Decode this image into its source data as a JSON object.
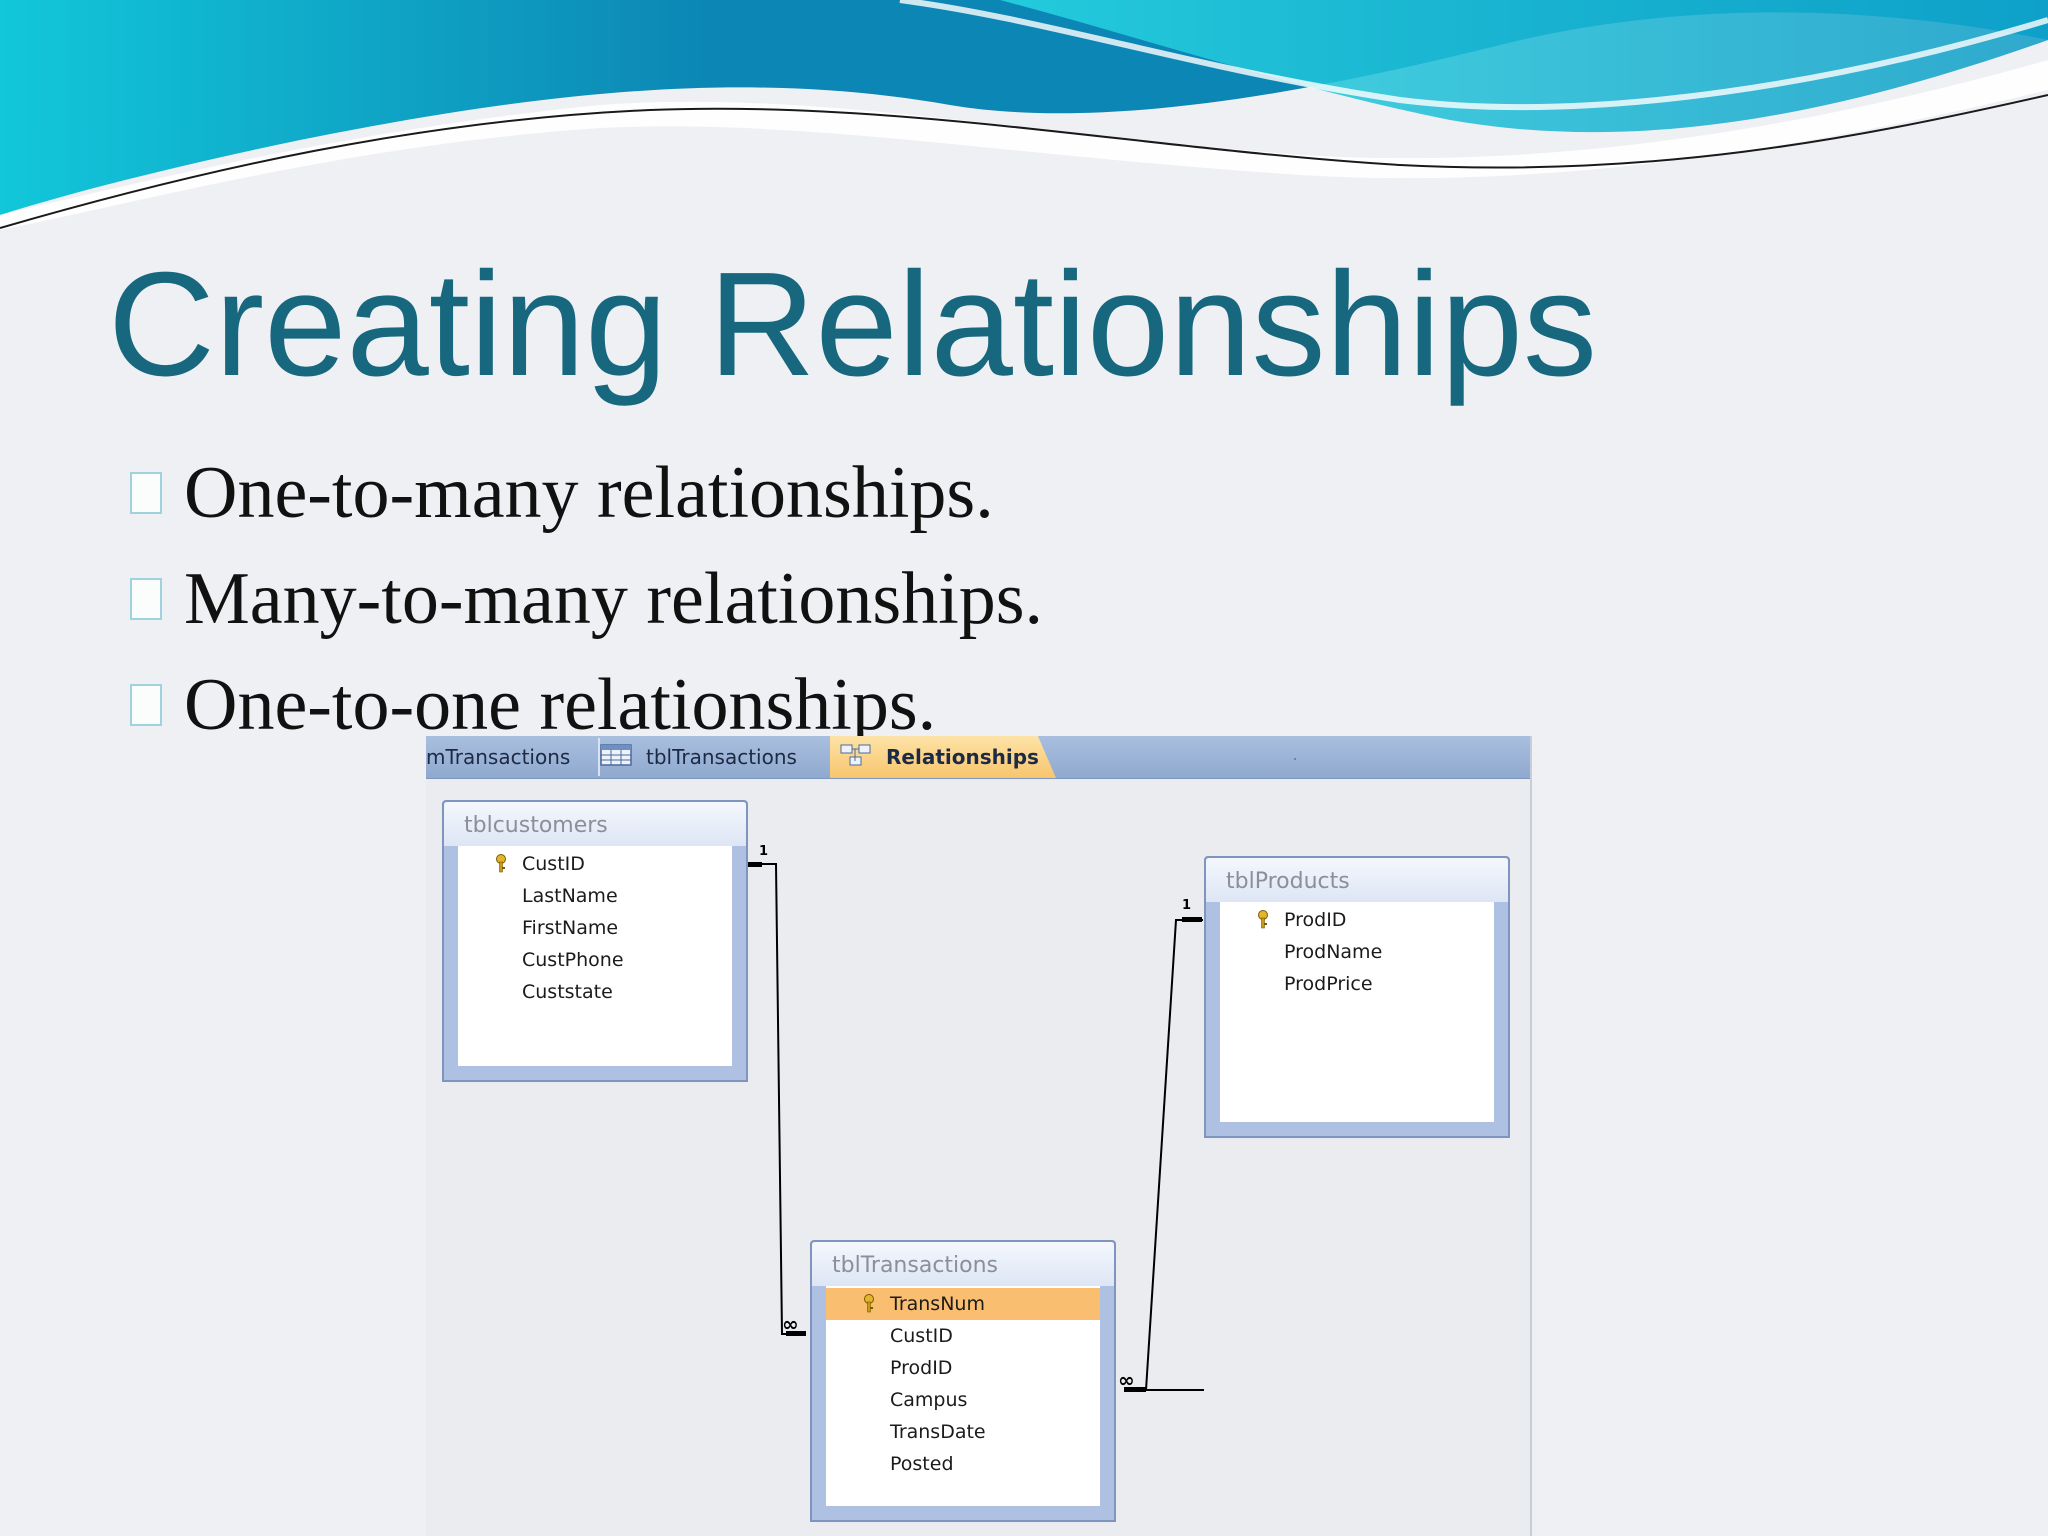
{
  "slide": {
    "title": "Creating Relationships",
    "bullets": [
      "One-to-many relationships.",
      "Many-to-many relationships.",
      "One-to-one relationships."
    ],
    "colors": {
      "title": "#17687f",
      "wave_dark": "#0c86b4",
      "wave_light": "#12c7da"
    }
  },
  "access": {
    "tabs": [
      {
        "label": "mTransactions",
        "icon": "none",
        "active": false
      },
      {
        "label": "tblTransactions",
        "icon": "table-icon",
        "active": false
      },
      {
        "label": "Relationships",
        "icon": "relationships-icon",
        "active": true
      }
    ],
    "tables": {
      "customers": {
        "title": "tblcustomers",
        "fields": [
          "CustID",
          "LastName",
          "FirstName",
          "CustPhone",
          "Custstate"
        ],
        "primary_key": "CustID"
      },
      "products": {
        "title": "tblProducts",
        "fields": [
          "ProdID",
          "ProdName",
          "ProdPrice"
        ],
        "primary_key": "ProdID"
      },
      "transactions": {
        "title": "tblTransactions",
        "fields": [
          "TransNum",
          "CustID",
          "ProdID",
          "Campus",
          "TransDate",
          "Posted"
        ],
        "primary_key": "TransNum",
        "selected_field": "TransNum"
      }
    },
    "relationships": [
      {
        "from": "tblcustomers.CustID",
        "to": "tblTransactions.CustID",
        "from_cardinality": "1",
        "to_cardinality": "∞"
      },
      {
        "from": "tblProducts.ProdID",
        "to": "tblTransactions.ProdID",
        "from_cardinality": "1",
        "to_cardinality": "∞"
      }
    ]
  }
}
